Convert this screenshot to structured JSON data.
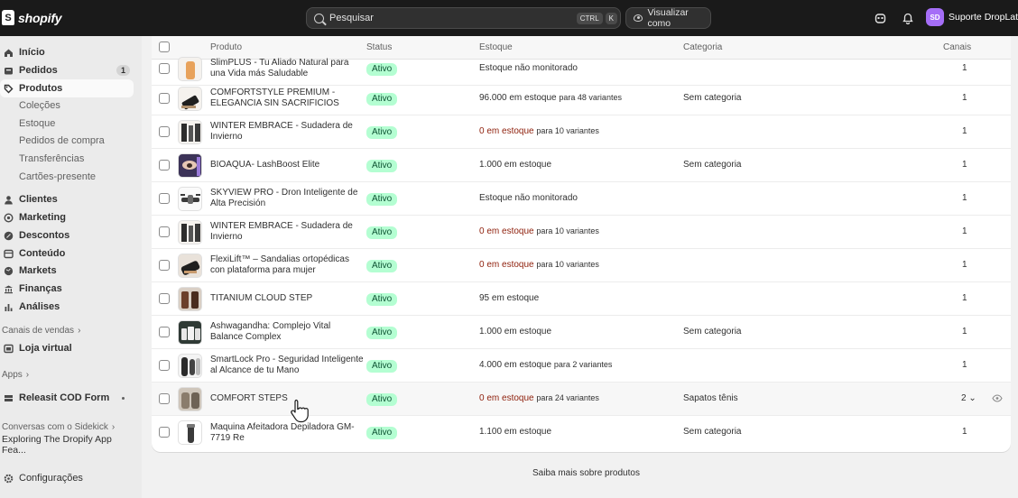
{
  "topbar": {
    "brand": "shopify",
    "search_placeholder": "Pesquisar",
    "shortcut_ctrl": "CTRL",
    "shortcut_k": "K",
    "view_as": "Visualizar como",
    "avatar_initials": "SD",
    "store_name": "Suporte DropLatam"
  },
  "sidebar": {
    "items": [
      {
        "label": "Início",
        "icon": "home-icon"
      },
      {
        "label": "Pedidos",
        "icon": "orders-icon",
        "badge": "1"
      },
      {
        "label": "Produtos",
        "icon": "tag-icon"
      },
      {
        "label": "Coleções"
      },
      {
        "label": "Estoque"
      },
      {
        "label": "Pedidos de compra"
      },
      {
        "label": "Transferências"
      },
      {
        "label": "Cartões-presente"
      },
      {
        "label": "Clientes",
        "icon": "person-icon"
      },
      {
        "label": "Marketing",
        "icon": "target-icon"
      },
      {
        "label": "Descontos",
        "icon": "discount-icon"
      },
      {
        "label": "Conteúdo",
        "icon": "content-icon"
      },
      {
        "label": "Markets",
        "icon": "globe-icon"
      },
      {
        "label": "Finanças",
        "icon": "bank-icon"
      },
      {
        "label": "Análises",
        "icon": "chart-icon"
      }
    ],
    "sales_channels": "Canais de vendas",
    "online_store": "Loja virtual",
    "apps": "Apps",
    "app_item": "Releasit COD Form",
    "sidekick": "Conversas com o Sidekick",
    "conversation": "Exploring The Dropify App Fea...",
    "settings": "Configurações"
  },
  "table": {
    "headers": {
      "product": "Produto",
      "status": "Status",
      "stock": "Estoque",
      "category": "Categoria",
      "channels": "Canais"
    },
    "rows": [
      {
        "name": "SlimPLUS - Tu Aliado Natural para una Vida más Saludable",
        "status": "Ativo",
        "stock_main": "Estoque não monitorado",
        "stock_var": "",
        "zero": false,
        "category": "",
        "channels": "1"
      },
      {
        "name": "COMFORTSTYLE PREMIUM - ELEGANCIA SIN SACRIFICIOS",
        "status": "Ativo",
        "stock_main": "96.000 em estoque",
        "stock_var": "para 48 variantes",
        "zero": false,
        "category": "Sem categoria",
        "channels": "1"
      },
      {
        "name": "WINTER EMBRACE - Sudadera de Invierno",
        "status": "Ativo",
        "stock_main": "0 em estoque",
        "stock_var": "para 10 variantes",
        "zero": true,
        "category": "",
        "channels": "1"
      },
      {
        "name": "BIOAQUA- LashBoost Elite",
        "status": "Ativo",
        "stock_main": "1.000 em estoque",
        "stock_var": "",
        "zero": false,
        "category": "Sem categoria",
        "channels": "1"
      },
      {
        "name": "SKYVIEW PRO - Dron Inteligente de Alta Precisión",
        "status": "Ativo",
        "stock_main": "Estoque não monitorado",
        "stock_var": "",
        "zero": false,
        "category": "",
        "channels": "1"
      },
      {
        "name": "WINTER EMBRACE - Sudadera de Invierno",
        "status": "Ativo",
        "stock_main": "0 em estoque",
        "stock_var": "para 10 variantes",
        "zero": true,
        "category": "",
        "channels": "1"
      },
      {
        "name": "FlexiLift™ – Sandalias ortopédicas con plataforma para mujer",
        "status": "Ativo",
        "stock_main": "0 em estoque",
        "stock_var": "para 10 variantes",
        "zero": true,
        "category": "",
        "channels": "1"
      },
      {
        "name": "TITANIUM CLOUD STEP",
        "status": "Ativo",
        "stock_main": "95 em estoque",
        "stock_var": "",
        "zero": false,
        "category": "",
        "channels": "1"
      },
      {
        "name": "Ashwagandha: Complejo Vital Balance Complex",
        "status": "Ativo",
        "stock_main": "1.000 em estoque",
        "stock_var": "",
        "zero": false,
        "category": "Sem categoria",
        "channels": "1"
      },
      {
        "name": "SmartLock Pro - Seguridad Inteligente al Alcance de tu Mano",
        "status": "Ativo",
        "stock_main": "4.000 em estoque",
        "stock_var": "para 2 variantes",
        "zero": false,
        "category": "",
        "channels": "1"
      },
      {
        "name": "COMFORT STEPS",
        "status": "Ativo",
        "stock_main": "0 em estoque",
        "stock_var": "para 24 variantes",
        "zero": true,
        "category": "Sapatos tênis",
        "channels": "2"
      },
      {
        "name": "Maquina Afeitadora Depiladora GM-7719 Re",
        "status": "Ativo",
        "stock_main": "1.100 em estoque",
        "stock_var": "",
        "zero": false,
        "category": "Sem categoria",
        "channels": "1"
      }
    ]
  },
  "footer_link": "Saiba mais sobre produtos"
}
